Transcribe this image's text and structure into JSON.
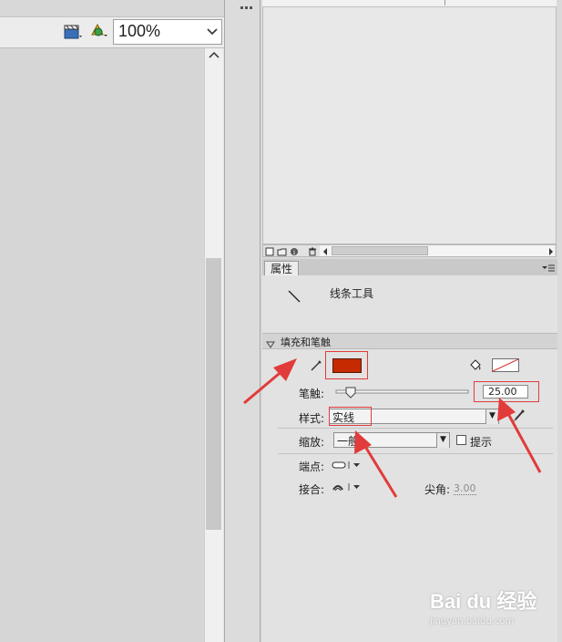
{
  "zoom": {
    "value": "100%",
    "options_visible": [
      "100%"
    ]
  },
  "properties": {
    "tab_label": "属性",
    "tool_name": "线条工具",
    "section_title": "填充和笔触",
    "stroke_color": "#c62a00",
    "stroke_size_label": "笔触",
    "stroke_size_value": "25.00",
    "style_label": "样式",
    "style_value": "实线",
    "scale_label": "缩放",
    "scale_value": "一般",
    "hint_label": "提示",
    "cap_label": "端点",
    "join_label": "接合",
    "miter_label": "尖角",
    "miter_value": "3.00",
    "colon": ":"
  },
  "watermark": {
    "brand": "Bai du 经验",
    "url": "jingyan.baidu.com"
  },
  "colors": {
    "annotation_red": "#e23b3b",
    "panel_bg": "#e2e2e2"
  }
}
